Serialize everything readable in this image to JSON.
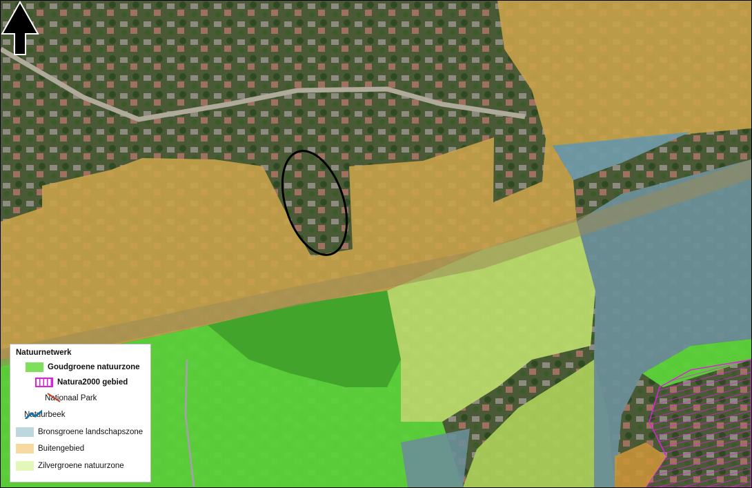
{
  "legend": {
    "title": "Natuurnetwerk",
    "items": [
      {
        "label": "Goudgroene natuurzone",
        "symbol": "fill",
        "color": "#7ee05a",
        "bold": true
      },
      {
        "label": "Natura2000 gebied",
        "symbol": "hatch",
        "color": "#e020e0",
        "bold": true
      },
      {
        "label": "Nationaal Park",
        "symbol": "diagonal-line",
        "color": "#c8401e",
        "bold": false
      },
      {
        "label": "Natuurbeek",
        "symbol": "stream-line",
        "color": "#1f6fa8",
        "bold": false
      },
      {
        "label": "Bronsgroene landschapszone",
        "symbol": "fill",
        "color": "#bcd8dc",
        "bold": false
      },
      {
        "label": "Buitengebied",
        "symbol": "fill",
        "color": "#f8d9a0",
        "bold": false
      },
      {
        "label": "Zilvergroene natuurzone",
        "symbol": "fill",
        "color": "#e2f7b8",
        "bold": false
      }
    ]
  },
  "map": {
    "location_marker": "ellipse-outline",
    "north_arrow": "north-arrow-icon",
    "zone_colors": {
      "buitengebied": "#c9a24a",
      "goudgroene": "#5bd23a",
      "zilvergroene": "#b8d96a",
      "bronsgroene": "#6a8f98",
      "natura2000": "#e020e0"
    }
  }
}
